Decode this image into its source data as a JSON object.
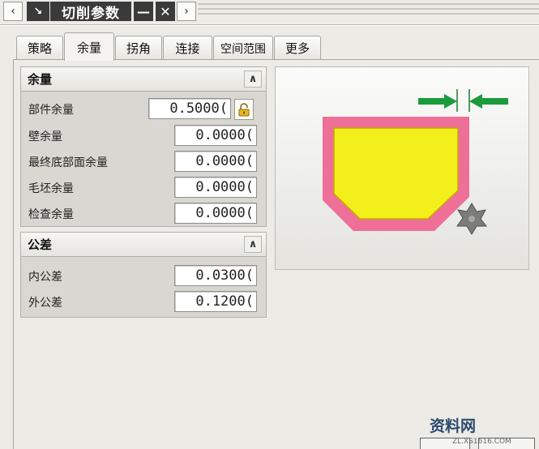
{
  "title": {
    "text": "切削参数"
  },
  "tabs": [
    {
      "label": "策略"
    },
    {
      "label": "余量"
    },
    {
      "label": "拐角"
    },
    {
      "label": "连接"
    },
    {
      "label": "空间范围"
    },
    {
      "label": "更多"
    }
  ],
  "stock_group": {
    "title": "余量",
    "rows": [
      {
        "label": "部件余量",
        "value": "0.5000("
      },
      {
        "label": "壁余量",
        "value": "0.0000("
      },
      {
        "label": "最终底部面余量",
        "value": "0.0000("
      },
      {
        "label": "毛坯余量",
        "value": "0.0000("
      },
      {
        "label": "检查余量",
        "value": "0.0000("
      }
    ]
  },
  "tolerance_group": {
    "title": "公差",
    "rows": [
      {
        "label": "内公差",
        "value": "0.0300("
      },
      {
        "label": "外公差",
        "value": "0.1200("
      }
    ]
  },
  "colors": {
    "part_fill": "#f2ef1a",
    "stock_outline": "#ee6f98",
    "arrow_green": "#1b9b3c"
  },
  "watermark": {
    "text": "资料网",
    "url": "ZL.XS1616.COM"
  }
}
